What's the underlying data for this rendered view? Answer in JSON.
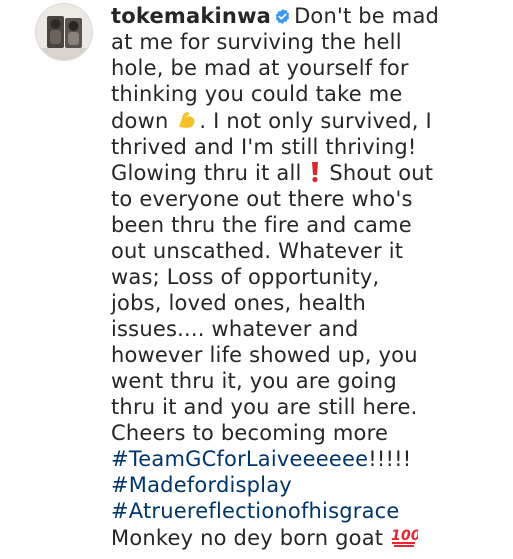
{
  "post": {
    "username": "tokemakinwa",
    "verified": true,
    "colors": {
      "text": "#262626",
      "hashtag": "#003569",
      "verified_badge": "#3897f0"
    },
    "icons": {
      "verified": "verified-badge-icon",
      "muscle": "flexed-biceps-emoji",
      "exclamation": "red-exclamation-emoji",
      "hundred": "hundred-points-emoji"
    },
    "caption": {
      "line1": "Don't be mad",
      "line2": "at me for surviving the hell",
      "line3": "hole, be mad at yourself for",
      "line4": "thinking you could take me",
      "line5a": "down",
      "line5b": ". I not only survived, I",
      "line6": "thrived and I'm still thriving!",
      "line7a": "Glowing thru it all",
      "line7b": "Shout out",
      "line8": "to everyone out there who's",
      "line9": "been thru the fire and came",
      "line10": "out unscathed. Whatever it",
      "line11": "was; Loss of opportunity,",
      "line12": "jobs, loved ones, health",
      "line13": "issues.... whatever and",
      "line14": "however life showed up, you",
      "line15": "went thru it, you are going",
      "line16": "thru it and you are still here.",
      "line17": "Cheers to becoming more",
      "hashtag1": "#TeamGCforLaiveeeeee",
      "hashtag1_tail": "!!!!!",
      "hashtag2": "#Madefordisplay",
      "hashtag3": "#Atruereflectionofhisgrace",
      "line21": "Monkey no dey born goat"
    }
  }
}
